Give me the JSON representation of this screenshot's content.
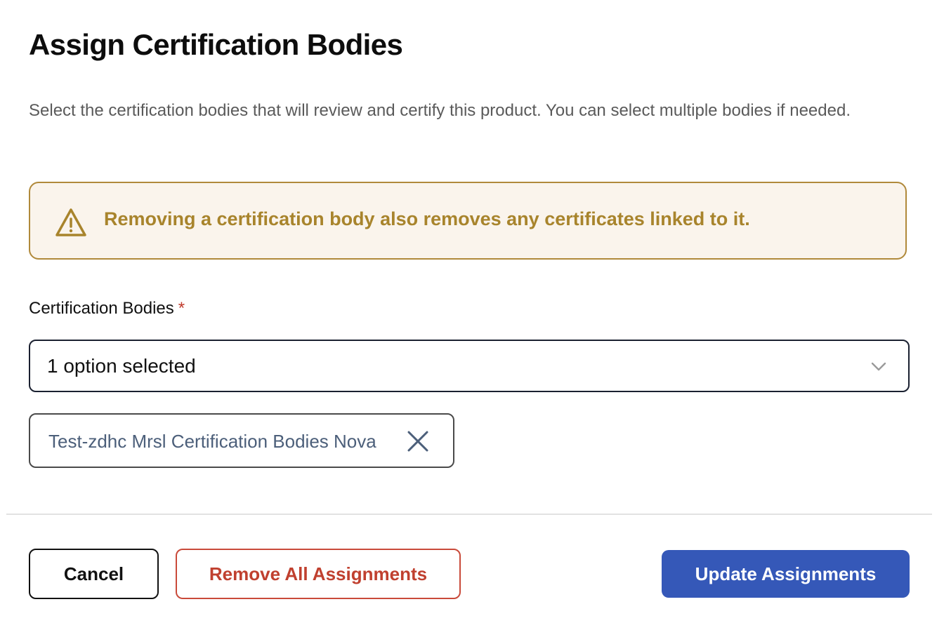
{
  "dialog": {
    "title": "Assign Certification Bodies",
    "description": "Select the certification bodies that will review and certify this product. You can select multiple bodies if needed.",
    "warning": {
      "icon": "warning-triangle-icon",
      "text": "Removing a certification body also removes any certificates linked to it."
    },
    "field": {
      "label": "Certification Bodies",
      "required_mark": "*",
      "select_value": "1 option selected",
      "chevron_icon": "chevron-down-icon"
    },
    "selected_chips": [
      {
        "label": "Test-zdhc Mrsl Certification Bodies Nova",
        "remove_icon": "close-icon"
      }
    ],
    "buttons": {
      "cancel": "Cancel",
      "remove_all": "Remove All Assignments",
      "update": "Update Assignments"
    }
  },
  "colors": {
    "warning_border": "#b0893a",
    "warning_bg": "#faf4ec",
    "warning_text": "#a8842c",
    "danger": "#c0402f",
    "primary": "#3558b8",
    "chip_text": "#4c5f7a"
  }
}
